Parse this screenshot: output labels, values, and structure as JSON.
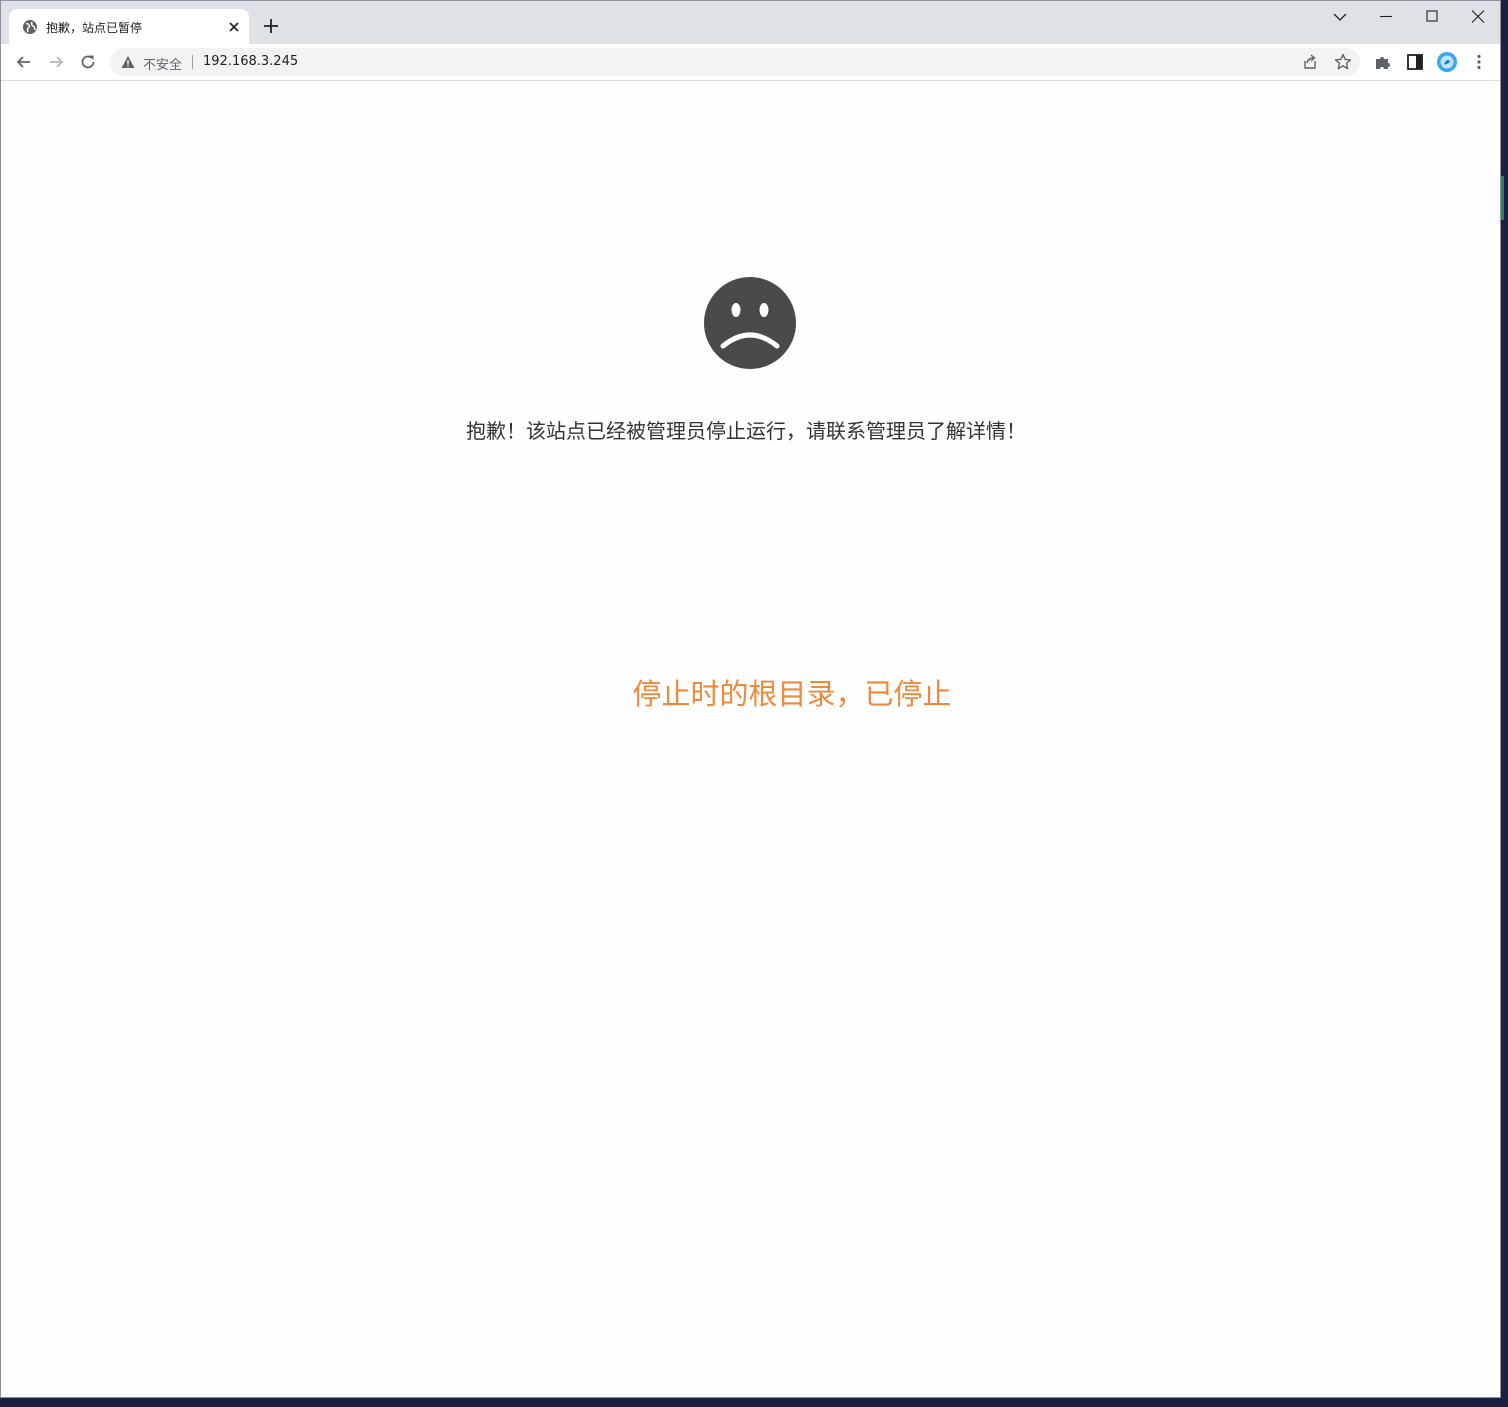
{
  "browser": {
    "tab": {
      "title": "抱歉，站点已暂停",
      "favicon": "globe-icon"
    },
    "address_bar": {
      "security_label": "不安全",
      "url": "192.168.3.245"
    },
    "icons": {
      "back": "back-arrow-icon",
      "forward": "forward-arrow-icon",
      "reload": "reload-icon",
      "share": "share-icon",
      "bookmark": "star-icon",
      "extensions": "puzzle-icon",
      "side_panel": "side-panel-icon",
      "profile": "profile-avatar-icon",
      "menu": "more-vert-icon"
    }
  },
  "page": {
    "message": "抱歉！该站点已经被管理员停止运行，请联系管理员了解详情！",
    "root_note": "停止时的根目录，已停止",
    "colors": {
      "face": "#4a4a4a",
      "message_text": "#333333",
      "root_note_text": "#f0883c"
    }
  }
}
